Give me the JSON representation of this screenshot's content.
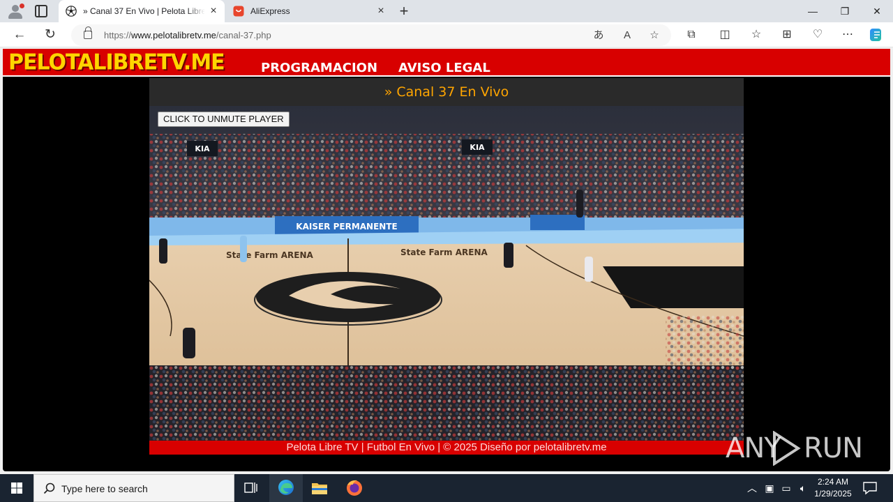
{
  "browser": {
    "tabs": [
      {
        "title": "» Canal 37 En Vivo | Pelota Libre TV",
        "active": true,
        "favicon": "soccer-ball-icon"
      },
      {
        "title": "AliExpress",
        "active": false,
        "favicon": "aliexpress-bag-icon"
      }
    ],
    "url": {
      "scheme_prefix": "https://",
      "host": "www.pelotalibretv.me",
      "path": "/canal-37.php"
    }
  },
  "site": {
    "logo": "PELOTALIBRETV.ME",
    "nav": [
      "PROGRAMACION",
      "AVISO LEGAL"
    ],
    "channel_title": "» Canal 37 En Vivo",
    "unmute_label": "CLICK TO UNMUTE PLAYER",
    "footer": "Pelota Libre TV | Futbol En Vivo | © 2025 Diseño por pelotalibretv.me",
    "video_text": {
      "sponsor": "KAISER PERMANENTE",
      "arena": "State Farm ARENA",
      "kia": "KIA"
    },
    "colors": {
      "header_red": "#d80000",
      "logo_yellow": "#ffd500",
      "channel_orange": "#ffa500"
    }
  },
  "watermark": {
    "left": "ANY",
    "right": "RUN"
  },
  "taskbar": {
    "search_placeholder": "Type here to search",
    "apps": [
      "task-view-icon",
      "edge-icon",
      "file-explorer-icon",
      "firefox-icon"
    ],
    "time": "2:24 AM",
    "date": "1/29/2025"
  }
}
